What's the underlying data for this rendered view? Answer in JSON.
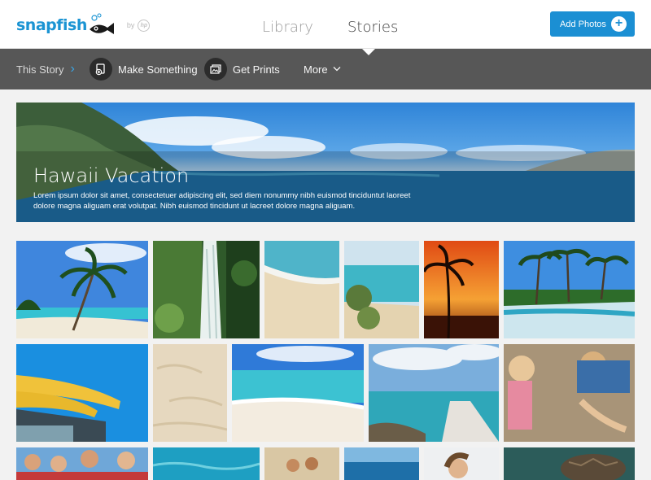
{
  "header": {
    "brand": "snapfish",
    "by_label": "by",
    "hp_mark": "hp",
    "tabs": [
      {
        "label": "Library",
        "active": false
      },
      {
        "label": "Stories",
        "active": true
      }
    ],
    "add_photos_label": "Add Photos",
    "add_icon": "plus-circle-icon"
  },
  "toolbar": {
    "breadcrumb_label": "This Story",
    "make_something_label": "Make Something",
    "get_prints_label": "Get Prints",
    "more_label": "More"
  },
  "story": {
    "title": "Hawaii Vacation",
    "description": "Lorem ipsum dolor sit amet, consectetuer adipiscing elit, sed diem nonummy nibh euismod tinciduntut laoreet dolore magna aliguam erat volutpat. Nibh euismod tincidunt ut lacreet dolore magna aliguam."
  },
  "photos": [
    "palm tree on beach",
    "jungle waterfall",
    "sandy shoreline",
    "beach with shrubs",
    "palm tree at sunset",
    "palm trees along coast",
    "surfboards on car roof",
    "sand texture",
    "turquoise waves on beach",
    "wooden dock over water",
    "kids playing in sand",
    "family portrait",
    "ocean water",
    "couple on beach",
    "open ocean",
    "woman smiling",
    "sea turtle"
  ],
  "colors": {
    "brand_blue": "#1b94d3",
    "button_blue": "#1b8fd3",
    "toolbar_gray": "#575757",
    "page_bg": "#f2f2f2"
  }
}
